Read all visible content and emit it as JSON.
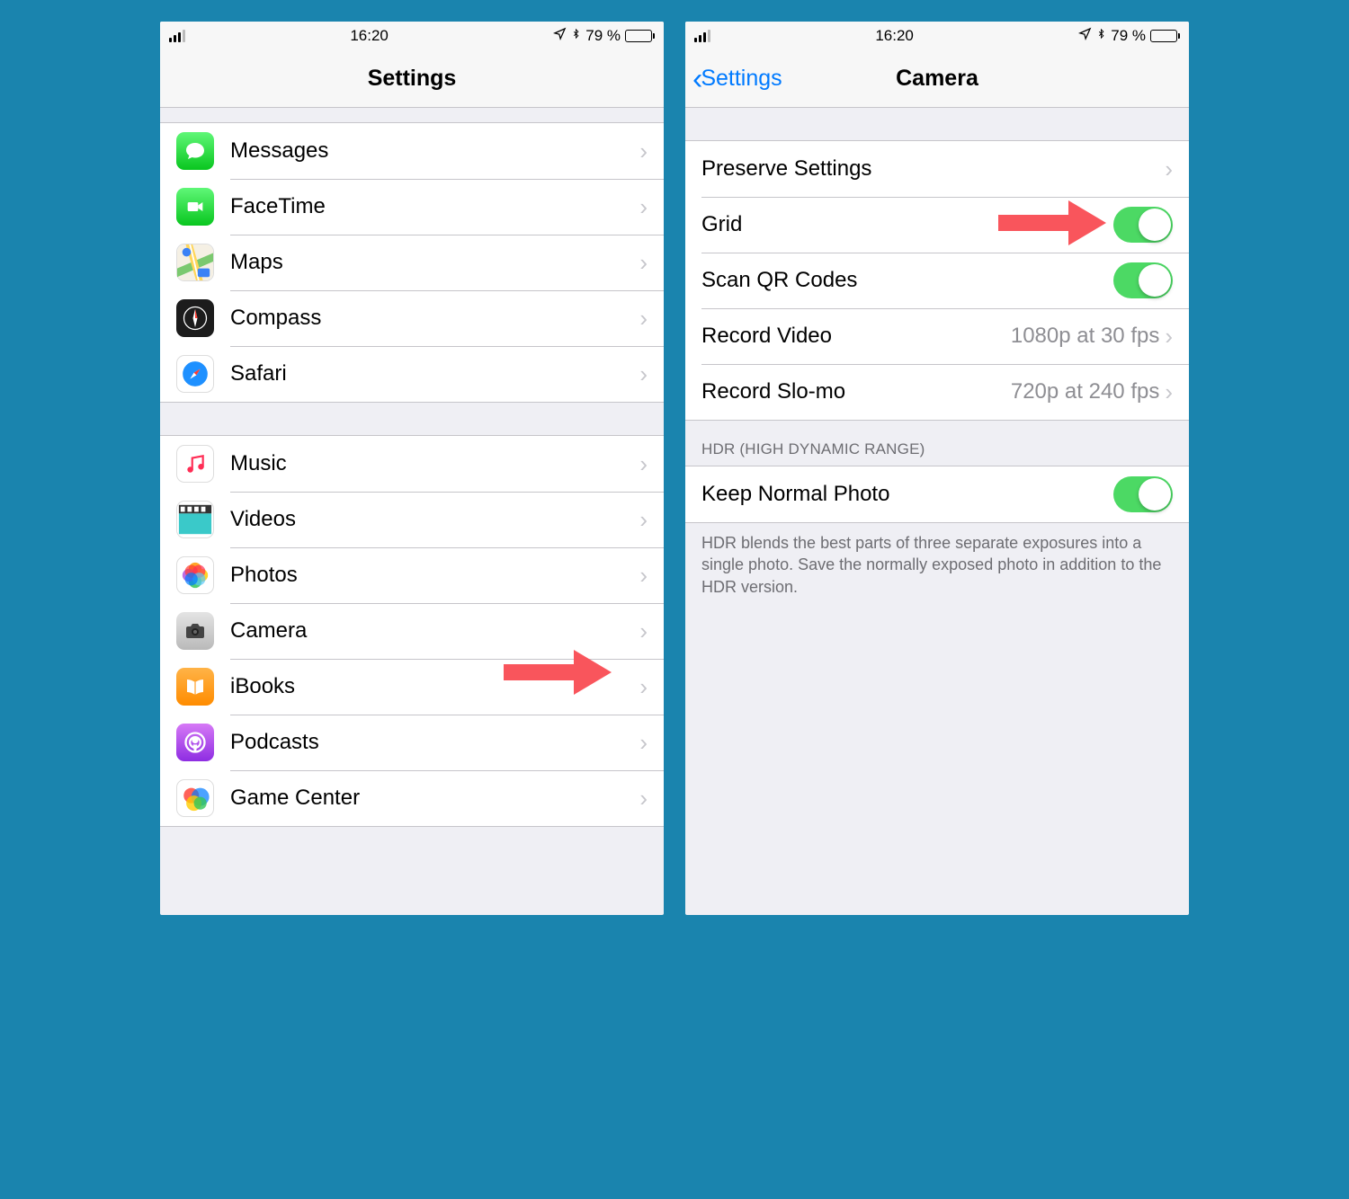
{
  "status": {
    "time": "16:20",
    "battery_text": "79 %"
  },
  "left": {
    "title": "Settings",
    "group1": [
      {
        "label": "Messages"
      },
      {
        "label": "FaceTime"
      },
      {
        "label": "Maps"
      },
      {
        "label": "Compass"
      },
      {
        "label": "Safari"
      }
    ],
    "group2": [
      {
        "label": "Music"
      },
      {
        "label": "Videos"
      },
      {
        "label": "Photos"
      },
      {
        "label": "Camera"
      },
      {
        "label": "iBooks"
      },
      {
        "label": "Podcasts"
      },
      {
        "label": "Game Center"
      }
    ]
  },
  "right": {
    "back_label": "Settings",
    "title": "Camera",
    "rows": {
      "preserve": {
        "label": "Preserve Settings"
      },
      "grid": {
        "label": "Grid",
        "on": true
      },
      "qr": {
        "label": "Scan QR Codes",
        "on": true
      },
      "video": {
        "label": "Record Video",
        "detail": "1080p at 30 fps"
      },
      "slomo": {
        "label": "Record Slo-mo",
        "detail": "720p at 240 fps"
      }
    },
    "hdr_header": "HDR (HIGH DYNAMIC RANGE)",
    "hdr_row": {
      "label": "Keep Normal Photo",
      "on": true
    },
    "hdr_footer": "HDR blends the best parts of three separate exposures into a single photo. Save the normally exposed photo in addition to the HDR version."
  }
}
